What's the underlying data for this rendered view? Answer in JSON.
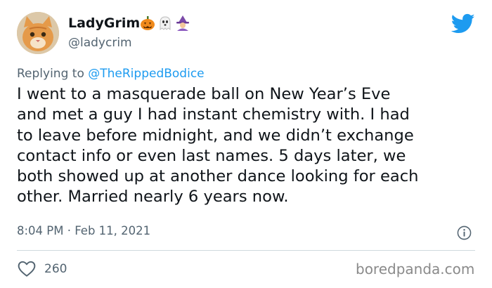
{
  "tweet": {
    "display_name": "LadyGrim",
    "name_emojis": [
      "jack-o-lantern-icon",
      "ghost-icon",
      "witch-icon"
    ],
    "handle": "@ladycrim",
    "reply_prefix": "Replying to",
    "reply_to": "@TheRippedBodice",
    "body_lines": [
      "I went to a masquerade ball on New Year’s Eve",
      "and met a guy I had instant chemistry with. I had",
      "to leave before midnight, and we didn’t exchange",
      "contact info or even last names. 5 days later, we",
      "both showed up at another dance looking for each",
      "other. Married nearly 6 years now."
    ],
    "timestamp": "8:04 PM · Feb 11, 2021",
    "like_count": "260"
  },
  "watermark": "boredpanda.com",
  "colors": {
    "twitter_blue": "#1d9bf0",
    "muted_text": "#536471",
    "body_text": "#0f1419",
    "divider": "#cfd9de"
  }
}
